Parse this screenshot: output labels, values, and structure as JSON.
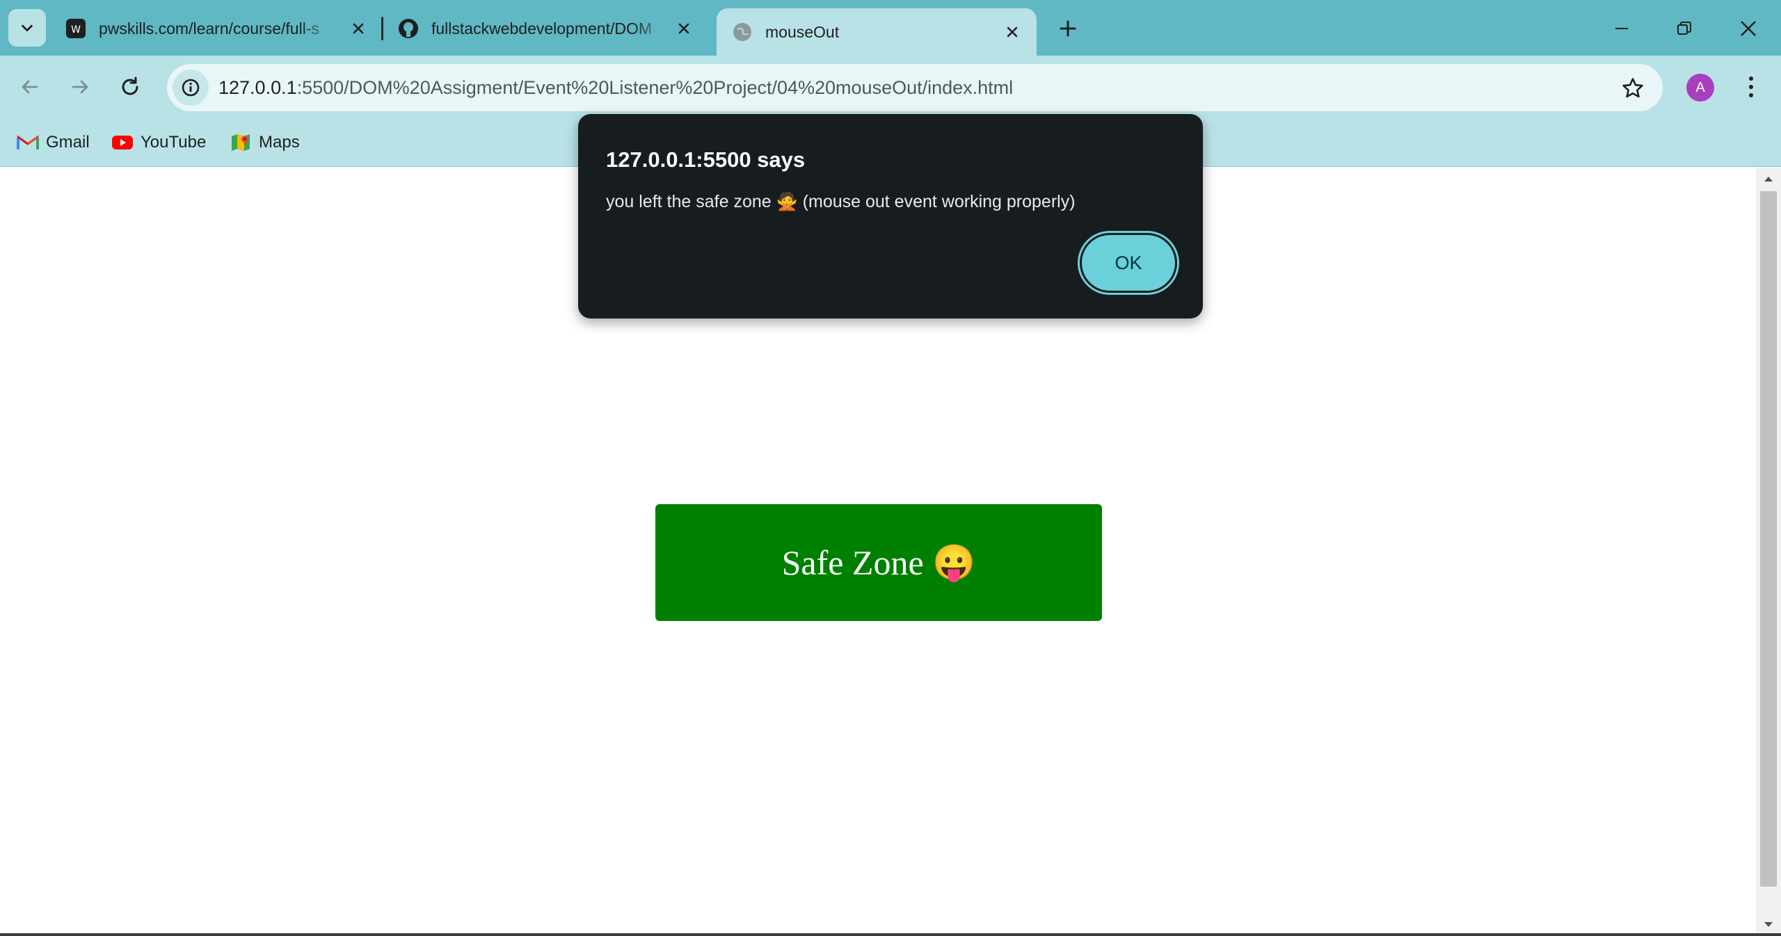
{
  "browser": {
    "tabs": [
      {
        "title": "pwskills.com/learn/course/full-s",
        "active": false
      },
      {
        "title": "fullstackwebdevelopment/DOM",
        "active": false
      },
      {
        "title": "mouseOut",
        "active": true
      }
    ],
    "address_bar": {
      "host": "127.0.0.1",
      "path": ":5500/DOM%20Assigment/Event%20Listener%20Project/04%20mouseOut/index.html"
    },
    "profile_initial": "A",
    "bookmarks": [
      {
        "label": "Gmail",
        "icon": "gmail-icon"
      },
      {
        "label": "YouTube",
        "icon": "youtube-icon"
      },
      {
        "label": "Maps",
        "icon": "maps-icon"
      }
    ],
    "colors": {
      "frame": "#5fb8c3",
      "toolbar": "#b9e2e7",
      "accent": "#6cd0da"
    }
  },
  "page": {
    "safe_zone_label": "Safe Zone 😛",
    "safe_zone_color": "#008000"
  },
  "alert": {
    "title": "127.0.0.1:5500 says",
    "message": "you left the safe zone 🙅 (mouse out event working properly)",
    "ok_label": "OK"
  }
}
